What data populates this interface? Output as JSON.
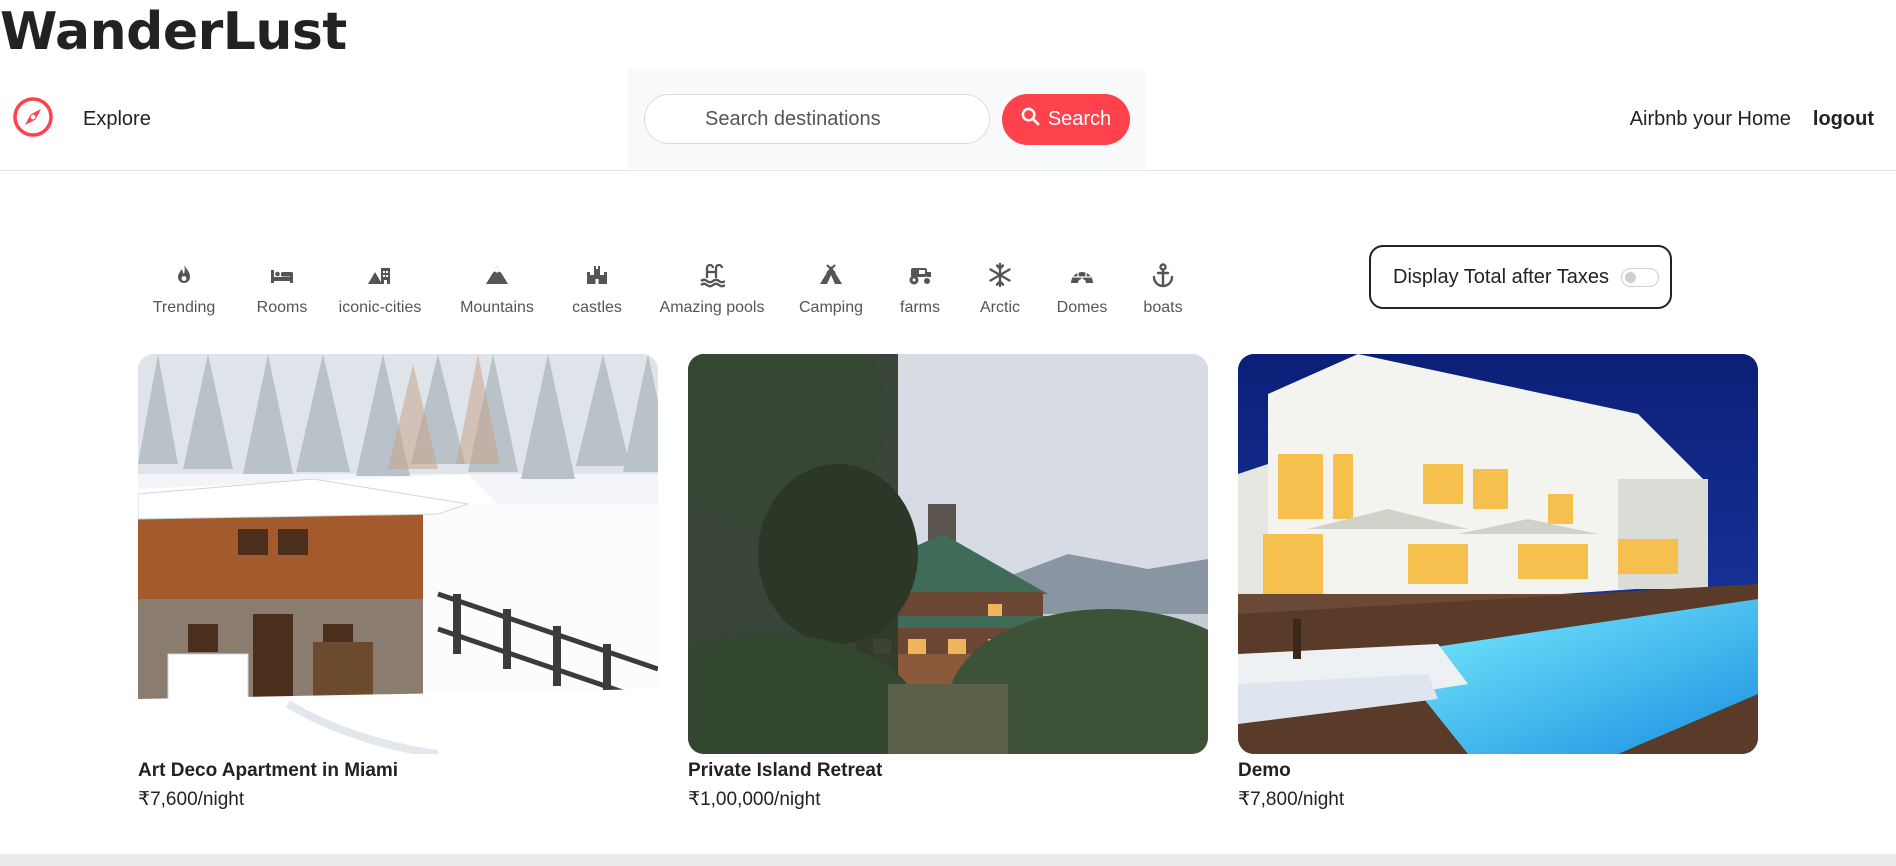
{
  "brand": {
    "name": "WanderLust"
  },
  "nav": {
    "explore_label": "Explore",
    "search_placeholder": "Search destinations",
    "search_button_label": "Search",
    "host_link": "Airbnb your Home",
    "logout_link": "logout",
    "accent_color": "#fe424d"
  },
  "filters": [
    {
      "label": "Trending",
      "icon": "fire-icon"
    },
    {
      "label": "Rooms",
      "icon": "bed-icon"
    },
    {
      "label": "iconic-cities",
      "icon": "city-icon"
    },
    {
      "label": "Mountains",
      "icon": "mountain-icon"
    },
    {
      "label": "castles",
      "icon": "castle-icon"
    },
    {
      "label": "Amazing pools",
      "icon": "pool-icon"
    },
    {
      "label": "Camping",
      "icon": "tent-icon"
    },
    {
      "label": "farms",
      "icon": "tractor-icon"
    },
    {
      "label": "Arctic",
      "icon": "snowflake-icon"
    },
    {
      "label": "Domes",
      "icon": "igloo-icon"
    },
    {
      "label": "boats",
      "icon": "anchor-icon"
    }
  ],
  "tax_toggle": {
    "label": "Display Total after Taxes",
    "enabled": false
  },
  "listings": [
    {
      "title": "Art Deco Apartment in Miami",
      "price": "₹7,600/night"
    },
    {
      "title": "Private Island Retreat",
      "price": "₹1,00,000/night"
    },
    {
      "title": "Demo",
      "price": "₹7,800/night"
    }
  ]
}
